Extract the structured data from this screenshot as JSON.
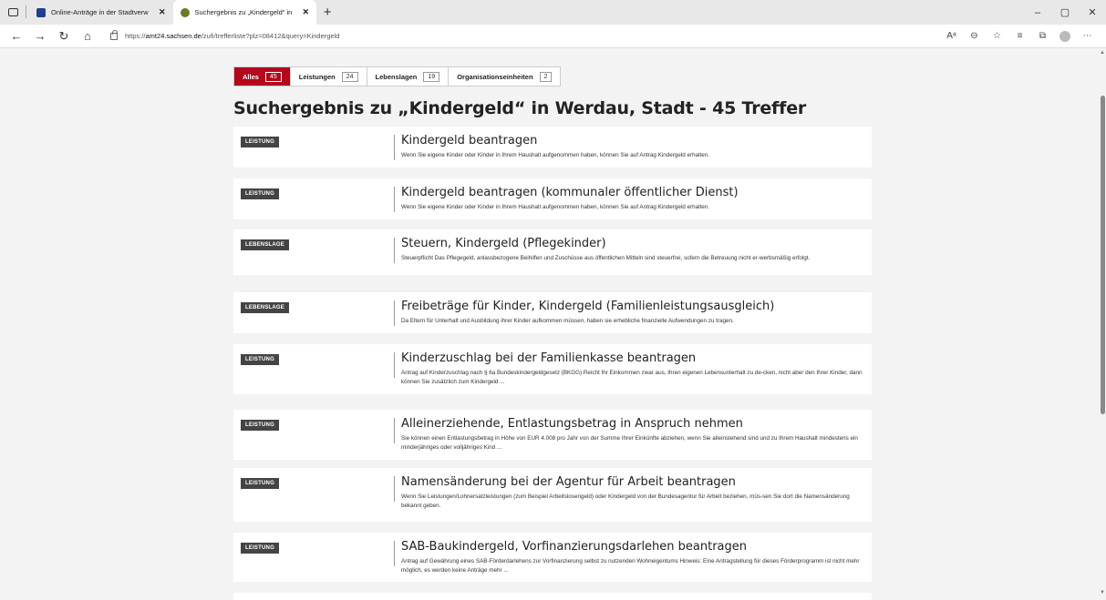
{
  "browser": {
    "tabs": [
      {
        "title": "Online-Anträge in der Stadtverw",
        "close": "✕"
      },
      {
        "title": "Suchergebnis zu „Kindergeld“ in",
        "close": "✕"
      }
    ],
    "new_tab": "+",
    "window_controls": {
      "minimize": "–",
      "maximize": "▢",
      "close": "✕"
    },
    "url_prefix": "https://",
    "url_host": "amt24.sachsen.de",
    "url_path": "/zufi/trefferliste?plz=08412&query=Kindergeld"
  },
  "filters": [
    {
      "label": "Alles",
      "count": "45"
    },
    {
      "label": "Leistungen",
      "count": "24"
    },
    {
      "label": "Lebenslagen",
      "count": "19"
    },
    {
      "label": "Organisationseinheiten",
      "count": "2"
    }
  ],
  "page_title": "Suchergebnis zu „Kindergeld“ in Werdau, Stadt - 45 Treffer",
  "results": [
    {
      "badge": "LEISTUNG",
      "title": "Kindergeld beantragen",
      "desc": "Wenn Sie eigene Kinder oder Kinder in Ihrem Haushalt aufgenommen haben, können Sie auf Antrag Kindergeld erhalten."
    },
    {
      "badge": "LEISTUNG",
      "title": "Kindergeld beantragen (kommunaler öffentlicher Dienst)",
      "desc": "Wenn Sie eigene Kinder oder Kinder in Ihrem Haushalt aufgenommen haben, können Sie auf Antrag Kindergeld erhalten."
    },
    {
      "badge": "LEBENSLAGE",
      "title": "Steuern, Kindergeld (Pflegekinder)",
      "desc": "Steuerpflicht Das Pflegegeld, anlassbezogene Beihilfen und Zuschüsse aus öffentlichen Mitteln sind steuerfrei, sofern die Betreuung nicht er-werbsmäßig erfolgt."
    },
    {
      "badge": "LEBENSLAGE",
      "title": "Freibeträge für Kinder, Kindergeld (Familienleistungsausgleich)",
      "desc": "Da Eltern für Unterhalt und Ausbildung ihrer Kinder aufkommen müssen, haben sie erhebliche finanzielle Aufwendungen zu tragen."
    },
    {
      "badge": "LEISTUNG",
      "title": "Kinderzuschlag bei der Familienkasse beantragen",
      "desc": "Antrag auf Kinderzuschlag nach § 6a Bundeskindergeldgesetz (BKGG) Reicht Ihr Einkommen zwar aus, Ihren eigenen Lebensunterhalt zu de-cken, nicht aber den Ihrer Kinder, dann können Sie zusätzlich zum Kindergeld ..."
    },
    {
      "badge": "LEISTUNG",
      "title": "Alleinerziehende, Entlastungsbetrag in Anspruch nehmen",
      "desc": "Sie können einen Entlastungsbetrag in Höhe von EUR 4.008 pro Jahr von der Summe Ihrer Einkünfte abziehen, wenn Sie alleinstehend sind und zu Ihrem Haushalt mindestens ein minderjähriges oder volljähriges Kind ..."
    },
    {
      "badge": "LEISTUNG",
      "title": "Namensänderung bei der Agentur für Arbeit beantragen",
      "desc": "Wenn Sie Leistungen/Lohnersatzleistungen (zum Beispiel Arbeitslosengeld) oder Kindergeld von der Bundesagentur für Arbeit beziehen, müs-sen Sie dort die Namensänderung bekannt geben."
    },
    {
      "badge": "LEISTUNG",
      "title": "SAB-Baukindergeld, Vorfinanzierungsdarlehen beantragen",
      "desc": "Antrag auf Gewährung eines SAB-Förderdarlehens zur Vorfinanzierung selbst zu nutzenden Wohneigentums Hinweis: Eine Antragstellung für dieses Förderprogramm ist nicht mehr möglich, es werden keine Anträge mehr ..."
    }
  ]
}
